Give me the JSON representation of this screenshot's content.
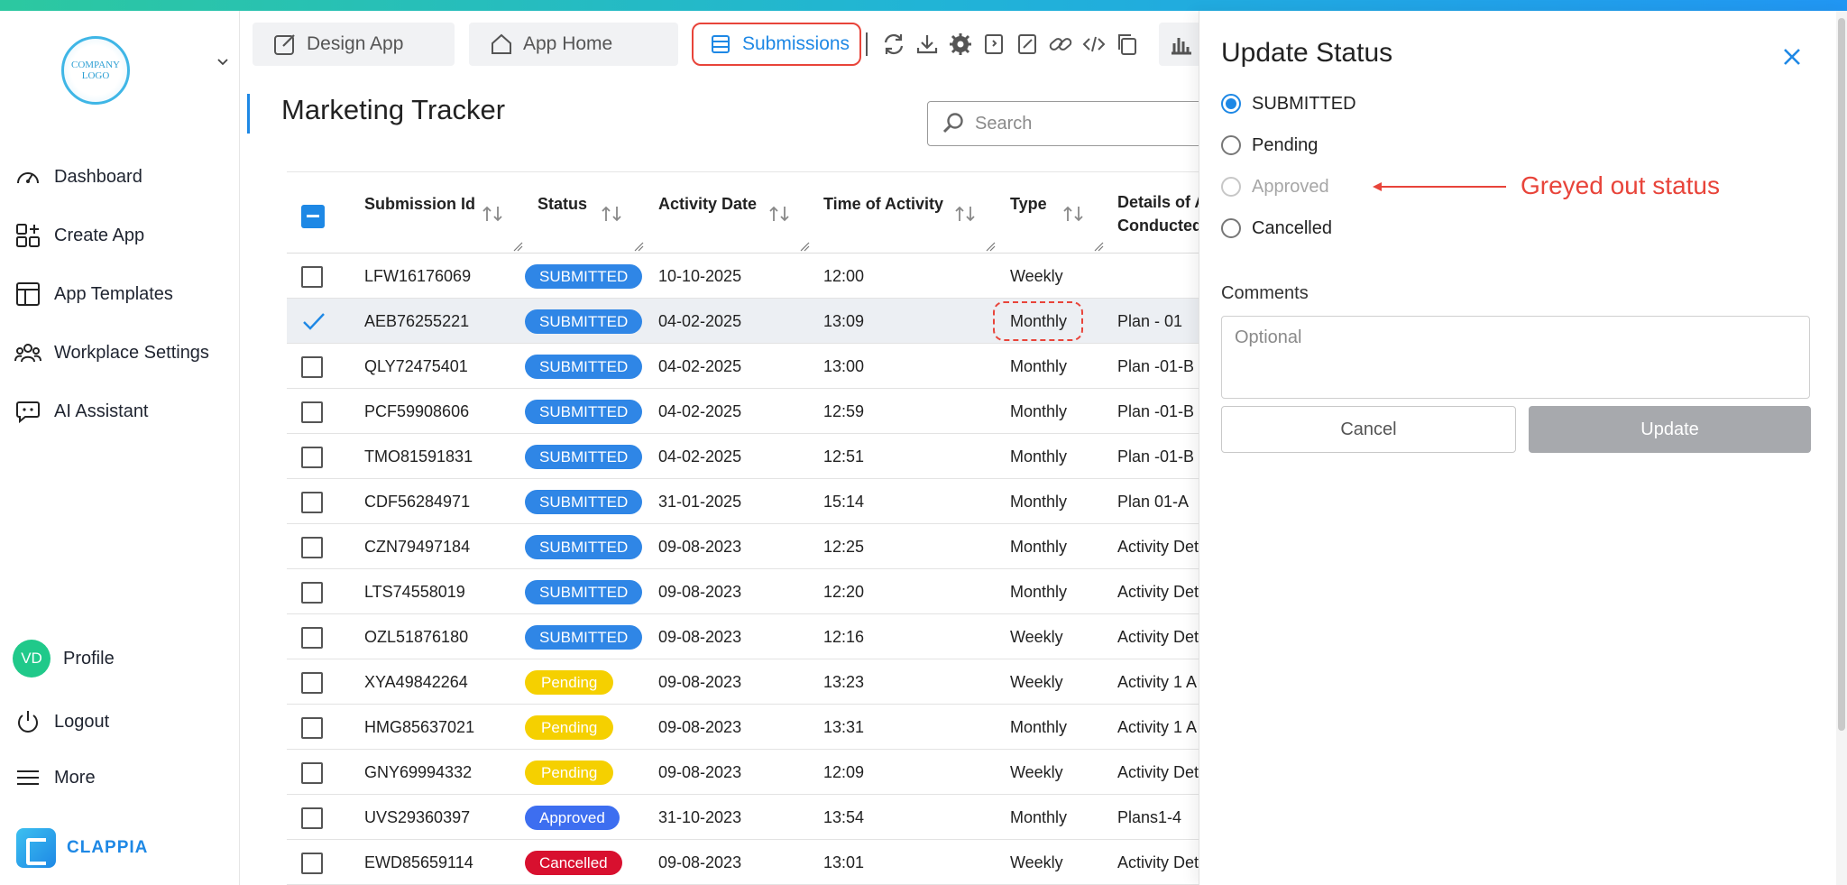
{
  "sidebar": {
    "logo_text": "COMPANY LOGO",
    "items": [
      {
        "label": "Dashboard",
        "icon": "gauge-icon"
      },
      {
        "label": "Create App",
        "icon": "grid-plus-icon"
      },
      {
        "label": "App Templates",
        "icon": "template-icon"
      },
      {
        "label": "Workplace Settings",
        "icon": "users-icon"
      },
      {
        "label": "AI Assistant",
        "icon": "chat-bot-icon"
      }
    ],
    "profile": {
      "initials": "VD",
      "label": "Profile"
    },
    "logout_label": "Logout",
    "more_label": "More",
    "brand": "CLAPPIA"
  },
  "tabs": {
    "design_app": "Design App",
    "app_home": "App Home",
    "submissions": "Submissions"
  },
  "toolbar_icons": [
    "refresh-icon",
    "download-icon",
    "settings-icon",
    "import-icon",
    "edit-icon",
    "link-icon",
    "code-icon",
    "copy-icon"
  ],
  "page": {
    "title": "Marketing Tracker",
    "search_placeholder": "Search"
  },
  "table": {
    "columns": [
      "Submission Id",
      "Status",
      "Activity Date",
      "Time of Activity",
      "Type",
      "Details of A",
      "Conducted"
    ],
    "rows": [
      {
        "id": "LFW16176069",
        "status": "SUBMITTED",
        "date": "10-10-2025",
        "time": "12:00",
        "type": "Weekly",
        "details": "",
        "selected": false
      },
      {
        "id": "AEB76255221",
        "status": "SUBMITTED",
        "date": "04-02-2025",
        "time": "13:09",
        "type": "Monthly",
        "details": "Plan - 01",
        "selected": true
      },
      {
        "id": "QLY72475401",
        "status": "SUBMITTED",
        "date": "04-02-2025",
        "time": "13:00",
        "type": "Monthly",
        "details": "Plan -01-B",
        "selected": false
      },
      {
        "id": "PCF59908606",
        "status": "SUBMITTED",
        "date": "04-02-2025",
        "time": "12:59",
        "type": "Monthly",
        "details": "Plan -01-B",
        "selected": false
      },
      {
        "id": "TMO81591831",
        "status": "SUBMITTED",
        "date": "04-02-2025",
        "time": "12:51",
        "type": "Monthly",
        "details": "Plan -01-B",
        "selected": false
      },
      {
        "id": "CDF56284971",
        "status": "SUBMITTED",
        "date": "31-01-2025",
        "time": "15:14",
        "type": "Monthly",
        "details": "Plan 01-A",
        "selected": false
      },
      {
        "id": "CZN79497184",
        "status": "SUBMITTED",
        "date": "09-08-2023",
        "time": "12:25",
        "type": "Monthly",
        "details": "Activity Det",
        "selected": false
      },
      {
        "id": "LTS74558019",
        "status": "SUBMITTED",
        "date": "09-08-2023",
        "time": "12:20",
        "type": "Monthly",
        "details": "Activity Det",
        "selected": false
      },
      {
        "id": "OZL51876180",
        "status": "SUBMITTED",
        "date": "09-08-2023",
        "time": "12:16",
        "type": "Weekly",
        "details": "Activity Det",
        "selected": false
      },
      {
        "id": "XYA49842264",
        "status": "Pending",
        "date": "09-08-2023",
        "time": "13:23",
        "type": "Weekly",
        "details": "Activity 1 A",
        "selected": false
      },
      {
        "id": "HMG85637021",
        "status": "Pending",
        "date": "09-08-2023",
        "time": "13:31",
        "type": "Monthly",
        "details": "Activity 1 A",
        "selected": false
      },
      {
        "id": "GNY69994332",
        "status": "Pending",
        "date": "09-08-2023",
        "time": "12:09",
        "type": "Weekly",
        "details": "Activity Det",
        "selected": false
      },
      {
        "id": "UVS29360397",
        "status": "Approved",
        "date": "31-10-2023",
        "time": "13:54",
        "type": "Monthly",
        "details": "Plans1-4",
        "selected": false
      },
      {
        "id": "EWD85659114",
        "status": "Cancelled",
        "date": "09-08-2023",
        "time": "13:01",
        "type": "Weekly",
        "details": "Activity Det",
        "selected": false
      }
    ]
  },
  "status_colors": {
    "SUBMITTED": "#2f86e6",
    "Pending": "#f5d000",
    "Approved": "#3d6ef0",
    "Cancelled": "#d8102f"
  },
  "panel": {
    "title": "Update Status",
    "options": [
      {
        "label": "SUBMITTED",
        "checked": true,
        "disabled": false
      },
      {
        "label": "Pending",
        "checked": false,
        "disabled": false
      },
      {
        "label": "Approved",
        "checked": false,
        "disabled": true
      },
      {
        "label": "Cancelled",
        "checked": false,
        "disabled": false
      }
    ],
    "annotation": "Greyed out status",
    "comments_label": "Comments",
    "comments_placeholder": "Optional",
    "cancel_label": "Cancel",
    "update_label": "Update"
  },
  "colors": {
    "accent": "#1e88e5",
    "annotation": "#e8443a",
    "disabled_button": "#a7a9ad"
  }
}
